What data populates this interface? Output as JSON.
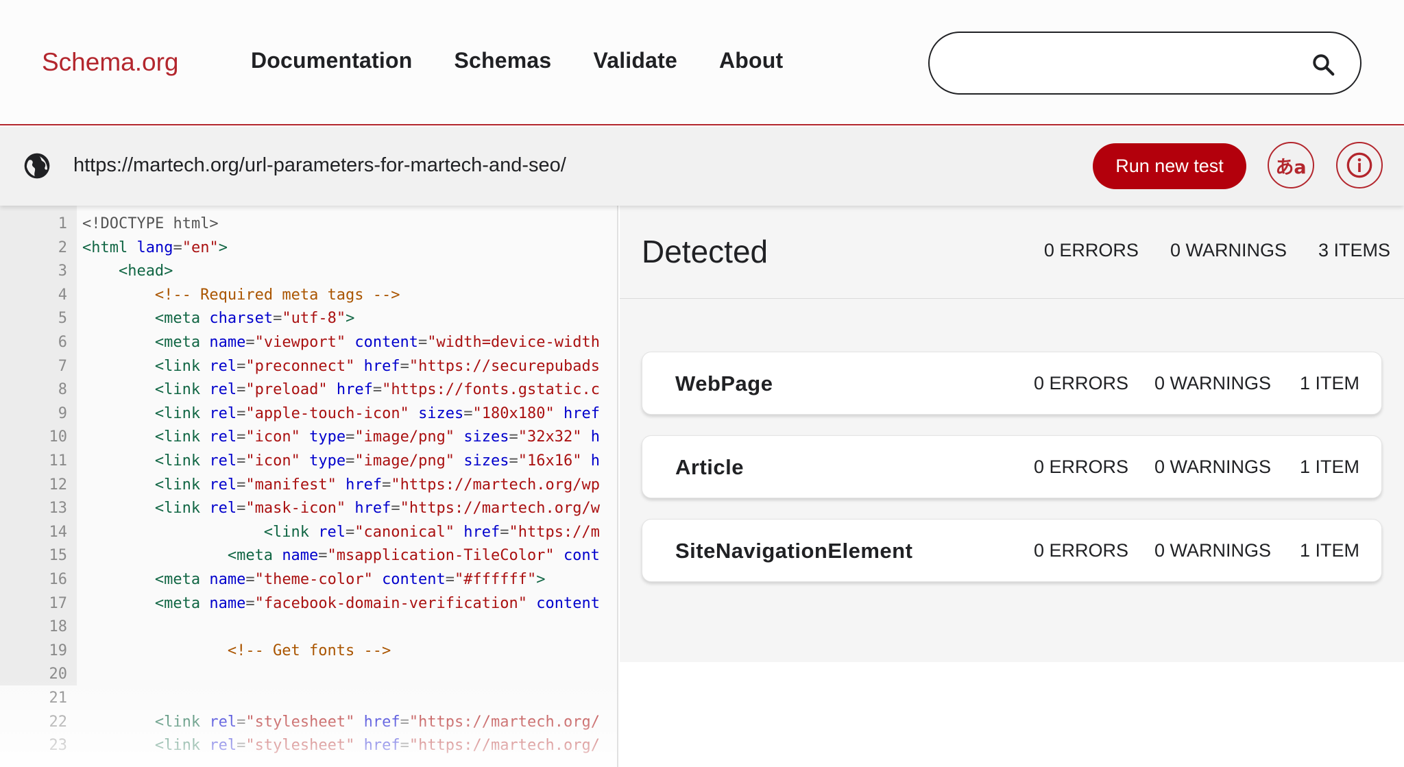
{
  "header": {
    "logo": "Schema.org",
    "nav": [
      "Documentation",
      "Schemas",
      "Validate",
      "About"
    ],
    "search": {
      "placeholder": "",
      "icon": "search-icon"
    }
  },
  "urlbar": {
    "icon": "globe-icon",
    "url": "https://martech.org/url-parameters-for-martech-and-seo/",
    "run_button": "Run new test",
    "language_button": "あa",
    "info_button_icon": "info-icon"
  },
  "code": {
    "lines": [
      {
        "n": "1",
        "indent": 0,
        "parts": [
          [
            "dt",
            "<!DOCTYPE html>"
          ]
        ]
      },
      {
        "n": "2",
        "indent": 0,
        "parts": [
          [
            "tag",
            "<html "
          ],
          [
            "attr",
            "lang"
          ],
          [
            "dt",
            "="
          ],
          [
            "str",
            "\"en\""
          ],
          [
            "tag",
            ">"
          ]
        ]
      },
      {
        "n": "3",
        "indent": 4,
        "parts": [
          [
            "tag",
            "<head>"
          ]
        ]
      },
      {
        "n": "4",
        "indent": 8,
        "parts": [
          [
            "cmt",
            "<!-- Required meta tags -->"
          ]
        ]
      },
      {
        "n": "5",
        "indent": 8,
        "parts": [
          [
            "tag",
            "<meta "
          ],
          [
            "attr",
            "charset"
          ],
          [
            "dt",
            "="
          ],
          [
            "str",
            "\"utf-8\""
          ],
          [
            "tag",
            ">"
          ]
        ]
      },
      {
        "n": "6",
        "indent": 8,
        "parts": [
          [
            "tag",
            "<meta "
          ],
          [
            "attr",
            "name"
          ],
          [
            "dt",
            "="
          ],
          [
            "str",
            "\"viewport\""
          ],
          [
            "dt",
            " "
          ],
          [
            "attr",
            "content"
          ],
          [
            "dt",
            "="
          ],
          [
            "str",
            "\"width=device-width"
          ]
        ]
      },
      {
        "n": "7",
        "indent": 8,
        "parts": [
          [
            "tag",
            "<link "
          ],
          [
            "attr",
            "rel"
          ],
          [
            "dt",
            "="
          ],
          [
            "str",
            "\"preconnect\""
          ],
          [
            "dt",
            " "
          ],
          [
            "attr",
            "href"
          ],
          [
            "dt",
            "="
          ],
          [
            "str",
            "\"https://securepubads"
          ]
        ]
      },
      {
        "n": "8",
        "indent": 8,
        "parts": [
          [
            "tag",
            "<link "
          ],
          [
            "attr",
            "rel"
          ],
          [
            "dt",
            "="
          ],
          [
            "str",
            "\"preload\""
          ],
          [
            "dt",
            " "
          ],
          [
            "attr",
            "href"
          ],
          [
            "dt",
            "="
          ],
          [
            "str",
            "\"https://fonts.gstatic.c"
          ]
        ]
      },
      {
        "n": "9",
        "indent": 8,
        "parts": [
          [
            "tag",
            "<link "
          ],
          [
            "attr",
            "rel"
          ],
          [
            "dt",
            "="
          ],
          [
            "str",
            "\"apple-touch-icon\""
          ],
          [
            "dt",
            " "
          ],
          [
            "attr",
            "sizes"
          ],
          [
            "dt",
            "="
          ],
          [
            "str",
            "\"180x180\""
          ],
          [
            "dt",
            " "
          ],
          [
            "attr",
            "href"
          ]
        ]
      },
      {
        "n": "10",
        "indent": 8,
        "parts": [
          [
            "tag",
            "<link "
          ],
          [
            "attr",
            "rel"
          ],
          [
            "dt",
            "="
          ],
          [
            "str",
            "\"icon\""
          ],
          [
            "dt",
            " "
          ],
          [
            "attr",
            "type"
          ],
          [
            "dt",
            "="
          ],
          [
            "str",
            "\"image/png\""
          ],
          [
            "dt",
            " "
          ],
          [
            "attr",
            "sizes"
          ],
          [
            "dt",
            "="
          ],
          [
            "str",
            "\"32x32\""
          ],
          [
            "dt",
            " "
          ],
          [
            "attr",
            "h"
          ]
        ]
      },
      {
        "n": "11",
        "indent": 8,
        "parts": [
          [
            "tag",
            "<link "
          ],
          [
            "attr",
            "rel"
          ],
          [
            "dt",
            "="
          ],
          [
            "str",
            "\"icon\""
          ],
          [
            "dt",
            " "
          ],
          [
            "attr",
            "type"
          ],
          [
            "dt",
            "="
          ],
          [
            "str",
            "\"image/png\""
          ],
          [
            "dt",
            " "
          ],
          [
            "attr",
            "sizes"
          ],
          [
            "dt",
            "="
          ],
          [
            "str",
            "\"16x16\""
          ],
          [
            "dt",
            " "
          ],
          [
            "attr",
            "h"
          ]
        ]
      },
      {
        "n": "12",
        "indent": 8,
        "parts": [
          [
            "tag",
            "<link "
          ],
          [
            "attr",
            "rel"
          ],
          [
            "dt",
            "="
          ],
          [
            "str",
            "\"manifest\""
          ],
          [
            "dt",
            " "
          ],
          [
            "attr",
            "href"
          ],
          [
            "dt",
            "="
          ],
          [
            "str",
            "\"https://martech.org/wp"
          ]
        ]
      },
      {
        "n": "13",
        "indent": 8,
        "parts": [
          [
            "tag",
            "<link "
          ],
          [
            "attr",
            "rel"
          ],
          [
            "dt",
            "="
          ],
          [
            "str",
            "\"mask-icon\""
          ],
          [
            "dt",
            " "
          ],
          [
            "attr",
            "href"
          ],
          [
            "dt",
            "="
          ],
          [
            "str",
            "\"https://martech.org/w"
          ]
        ]
      },
      {
        "n": "14",
        "indent": 20,
        "parts": [
          [
            "tag",
            "<link "
          ],
          [
            "attr",
            "rel"
          ],
          [
            "dt",
            "="
          ],
          [
            "str",
            "\"canonical\""
          ],
          [
            "dt",
            " "
          ],
          [
            "attr",
            "href"
          ],
          [
            "dt",
            "="
          ],
          [
            "str",
            "\"https://m"
          ]
        ]
      },
      {
        "n": "15",
        "indent": 16,
        "parts": [
          [
            "tag",
            "<meta "
          ],
          [
            "attr",
            "name"
          ],
          [
            "dt",
            "="
          ],
          [
            "str",
            "\"msapplication-TileColor\""
          ],
          [
            "dt",
            " "
          ],
          [
            "attr",
            "cont"
          ]
        ]
      },
      {
        "n": "16",
        "indent": 8,
        "parts": [
          [
            "tag",
            "<meta "
          ],
          [
            "attr",
            "name"
          ],
          [
            "dt",
            "="
          ],
          [
            "str",
            "\"theme-color\""
          ],
          [
            "dt",
            " "
          ],
          [
            "attr",
            "content"
          ],
          [
            "dt",
            "="
          ],
          [
            "str",
            "\"#ffffff\""
          ],
          [
            "tag",
            ">"
          ]
        ]
      },
      {
        "n": "17",
        "indent": 8,
        "parts": [
          [
            "tag",
            "<meta "
          ],
          [
            "attr",
            "name"
          ],
          [
            "dt",
            "="
          ],
          [
            "str",
            "\"facebook-domain-verification\""
          ],
          [
            "dt",
            " "
          ],
          [
            "attr",
            "content"
          ]
        ]
      },
      {
        "n": "18",
        "indent": 0,
        "parts": []
      },
      {
        "n": "19",
        "indent": 16,
        "parts": [
          [
            "cmt",
            "<!-- Get fonts -->"
          ]
        ]
      },
      {
        "n": "20",
        "indent": 0,
        "parts": []
      },
      {
        "n": "21",
        "indent": 0,
        "parts": []
      },
      {
        "n": "22",
        "indent": 8,
        "parts": [
          [
            "tag",
            "<link "
          ],
          [
            "attr",
            "rel"
          ],
          [
            "dt",
            "="
          ],
          [
            "str",
            "\"stylesheet\""
          ],
          [
            "dt",
            " "
          ],
          [
            "attr",
            "href"
          ],
          [
            "dt",
            "="
          ],
          [
            "str",
            "\"https://martech.org/"
          ]
        ]
      },
      {
        "n": "23",
        "indent": 8,
        "parts": [
          [
            "tag",
            "<link "
          ],
          [
            "attr",
            "rel"
          ],
          [
            "dt",
            "="
          ],
          [
            "str",
            "\"stylesheet\""
          ],
          [
            "dt",
            " "
          ],
          [
            "attr",
            "href"
          ],
          [
            "dt",
            "="
          ],
          [
            "str",
            "\"https://martech.org/"
          ]
        ]
      }
    ]
  },
  "results": {
    "title": "Detected",
    "errors": "0 ERRORS",
    "warnings": "0 WARNINGS",
    "items": "3 ITEMS",
    "cards": [
      {
        "name": "WebPage",
        "errors": "0 ERRORS",
        "warnings": "0 WARNINGS",
        "items": "1 ITEM"
      },
      {
        "name": "Article",
        "errors": "0 ERRORS",
        "warnings": "0 WARNINGS",
        "items": "1 ITEM"
      },
      {
        "name": "SiteNavigationElement",
        "errors": "0 ERRORS",
        "warnings": "0 WARNINGS",
        "items": "1 ITEM"
      }
    ]
  },
  "colors": {
    "brand": "#b3262d",
    "button": "#b3000c"
  }
}
